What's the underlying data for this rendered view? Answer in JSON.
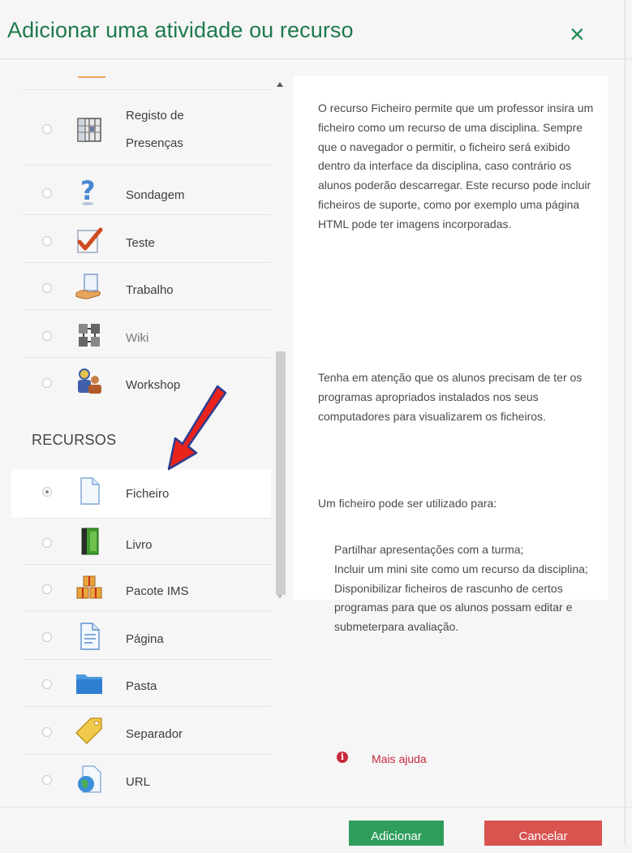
{
  "dialog": {
    "title": "Adicionar uma atividade ou recurso",
    "close_icon": "close-icon"
  },
  "activities": [
    {
      "label": "Registo de",
      "label2": "Presenças",
      "icon": "attendance-register-icon",
      "selected": false
    },
    {
      "label": "Sondagem",
      "icon": "question-mark-icon",
      "selected": false
    },
    {
      "label": "Teste",
      "icon": "checkmark-quiz-icon",
      "selected": false
    },
    {
      "label": "Trabalho",
      "icon": "hand-document-icon",
      "selected": false
    },
    {
      "label": "Wiki",
      "icon": "wiki-icon",
      "selected": false
    },
    {
      "label": "Workshop",
      "icon": "workshop-people-icon",
      "selected": false
    }
  ],
  "resources_heading": "RECURSOS",
  "resources": [
    {
      "label": "Ficheiro",
      "icon": "file-icon",
      "selected": true
    },
    {
      "label": "Livro",
      "icon": "book-icon",
      "selected": false
    },
    {
      "label": "Pacote IMS",
      "icon": "ims-package-icon",
      "selected": false
    },
    {
      "label": "Página",
      "icon": "page-icon",
      "selected": false
    },
    {
      "label": "Pasta",
      "icon": "folder-icon",
      "selected": false
    },
    {
      "label": "Separador",
      "icon": "tag-icon",
      "selected": false
    },
    {
      "label": "URL",
      "icon": "url-globe-icon",
      "selected": false
    }
  ],
  "help": {
    "paragraph1": "O recurso Ficheiro permite que um professor insira um ficheiro como um recurso de uma disciplina. Sempre que o navegador o permitir, o ficheiro será exibido dentro da interface da disciplina, caso contrário os alunos poderão descarregar. Este recurso pode incluir ficheiros de suporte, como por exemplo uma página HTML pode ter imagens incorporadas.",
    "paragraph2": "Tenha em atenção que os alunos precisam de ter os programas apropriados instalados nos seus computadores para visualizarem os ficheiros.",
    "paragraph3": "Um ficheiro pode ser utilizado para:",
    "list": [
      "Partilhar apresentações com a turma;",
      "Incluir um mini site como um recurso da disciplina;",
      "Disponibilizar ficheiros de rascunho de certos programas para que os alunos possam editar e submeterpara avaliação."
    ],
    "more_help": "Mais ajuda"
  },
  "footer": {
    "add_label": "Adicionar",
    "cancel_label": "Cancelar"
  },
  "colors": {
    "title_green": "#1e7a4b",
    "add_button": "#2f9e5c",
    "cancel_button": "#d9534f",
    "help_link": "#c7293b",
    "arrow_red": "#e8231b"
  }
}
